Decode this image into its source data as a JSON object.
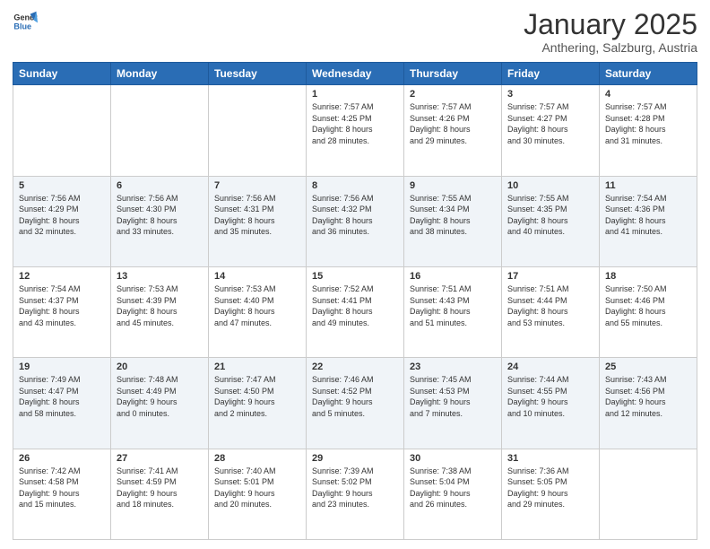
{
  "header": {
    "logo_line1": "General",
    "logo_line2": "Blue",
    "main_title": "January 2025",
    "subtitle": "Anthering, Salzburg, Austria"
  },
  "calendar": {
    "days_of_week": [
      "Sunday",
      "Monday",
      "Tuesday",
      "Wednesday",
      "Thursday",
      "Friday",
      "Saturday"
    ],
    "weeks": [
      [
        {
          "day": "",
          "info": ""
        },
        {
          "day": "",
          "info": ""
        },
        {
          "day": "",
          "info": ""
        },
        {
          "day": "1",
          "info": "Sunrise: 7:57 AM\nSunset: 4:25 PM\nDaylight: 8 hours\nand 28 minutes."
        },
        {
          "day": "2",
          "info": "Sunrise: 7:57 AM\nSunset: 4:26 PM\nDaylight: 8 hours\nand 29 minutes."
        },
        {
          "day": "3",
          "info": "Sunrise: 7:57 AM\nSunset: 4:27 PM\nDaylight: 8 hours\nand 30 minutes."
        },
        {
          "day": "4",
          "info": "Sunrise: 7:57 AM\nSunset: 4:28 PM\nDaylight: 8 hours\nand 31 minutes."
        }
      ],
      [
        {
          "day": "5",
          "info": "Sunrise: 7:56 AM\nSunset: 4:29 PM\nDaylight: 8 hours\nand 32 minutes."
        },
        {
          "day": "6",
          "info": "Sunrise: 7:56 AM\nSunset: 4:30 PM\nDaylight: 8 hours\nand 33 minutes."
        },
        {
          "day": "7",
          "info": "Sunrise: 7:56 AM\nSunset: 4:31 PM\nDaylight: 8 hours\nand 35 minutes."
        },
        {
          "day": "8",
          "info": "Sunrise: 7:56 AM\nSunset: 4:32 PM\nDaylight: 8 hours\nand 36 minutes."
        },
        {
          "day": "9",
          "info": "Sunrise: 7:55 AM\nSunset: 4:34 PM\nDaylight: 8 hours\nand 38 minutes."
        },
        {
          "day": "10",
          "info": "Sunrise: 7:55 AM\nSunset: 4:35 PM\nDaylight: 8 hours\nand 40 minutes."
        },
        {
          "day": "11",
          "info": "Sunrise: 7:54 AM\nSunset: 4:36 PM\nDaylight: 8 hours\nand 41 minutes."
        }
      ],
      [
        {
          "day": "12",
          "info": "Sunrise: 7:54 AM\nSunset: 4:37 PM\nDaylight: 8 hours\nand 43 minutes."
        },
        {
          "day": "13",
          "info": "Sunrise: 7:53 AM\nSunset: 4:39 PM\nDaylight: 8 hours\nand 45 minutes."
        },
        {
          "day": "14",
          "info": "Sunrise: 7:53 AM\nSunset: 4:40 PM\nDaylight: 8 hours\nand 47 minutes."
        },
        {
          "day": "15",
          "info": "Sunrise: 7:52 AM\nSunset: 4:41 PM\nDaylight: 8 hours\nand 49 minutes."
        },
        {
          "day": "16",
          "info": "Sunrise: 7:51 AM\nSunset: 4:43 PM\nDaylight: 8 hours\nand 51 minutes."
        },
        {
          "day": "17",
          "info": "Sunrise: 7:51 AM\nSunset: 4:44 PM\nDaylight: 8 hours\nand 53 minutes."
        },
        {
          "day": "18",
          "info": "Sunrise: 7:50 AM\nSunset: 4:46 PM\nDaylight: 8 hours\nand 55 minutes."
        }
      ],
      [
        {
          "day": "19",
          "info": "Sunrise: 7:49 AM\nSunset: 4:47 PM\nDaylight: 8 hours\nand 58 minutes."
        },
        {
          "day": "20",
          "info": "Sunrise: 7:48 AM\nSunset: 4:49 PM\nDaylight: 9 hours\nand 0 minutes."
        },
        {
          "day": "21",
          "info": "Sunrise: 7:47 AM\nSunset: 4:50 PM\nDaylight: 9 hours\nand 2 minutes."
        },
        {
          "day": "22",
          "info": "Sunrise: 7:46 AM\nSunset: 4:52 PM\nDaylight: 9 hours\nand 5 minutes."
        },
        {
          "day": "23",
          "info": "Sunrise: 7:45 AM\nSunset: 4:53 PM\nDaylight: 9 hours\nand 7 minutes."
        },
        {
          "day": "24",
          "info": "Sunrise: 7:44 AM\nSunset: 4:55 PM\nDaylight: 9 hours\nand 10 minutes."
        },
        {
          "day": "25",
          "info": "Sunrise: 7:43 AM\nSunset: 4:56 PM\nDaylight: 9 hours\nand 12 minutes."
        }
      ],
      [
        {
          "day": "26",
          "info": "Sunrise: 7:42 AM\nSunset: 4:58 PM\nDaylight: 9 hours\nand 15 minutes."
        },
        {
          "day": "27",
          "info": "Sunrise: 7:41 AM\nSunset: 4:59 PM\nDaylight: 9 hours\nand 18 minutes."
        },
        {
          "day": "28",
          "info": "Sunrise: 7:40 AM\nSunset: 5:01 PM\nDaylight: 9 hours\nand 20 minutes."
        },
        {
          "day": "29",
          "info": "Sunrise: 7:39 AM\nSunset: 5:02 PM\nDaylight: 9 hours\nand 23 minutes."
        },
        {
          "day": "30",
          "info": "Sunrise: 7:38 AM\nSunset: 5:04 PM\nDaylight: 9 hours\nand 26 minutes."
        },
        {
          "day": "31",
          "info": "Sunrise: 7:36 AM\nSunset: 5:05 PM\nDaylight: 9 hours\nand 29 minutes."
        },
        {
          "day": "",
          "info": ""
        }
      ]
    ]
  }
}
